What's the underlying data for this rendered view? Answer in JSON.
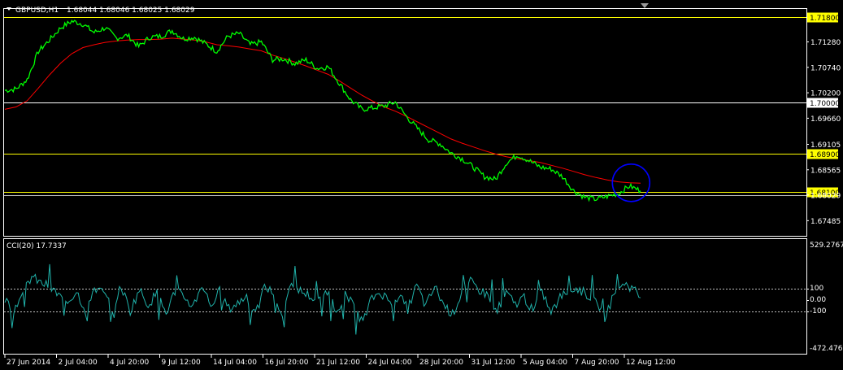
{
  "header": {
    "symbol": "GBPUSD,H1",
    "ohlc": "1.68044 1.68046 1.68025 1.68029"
  },
  "colors": {
    "background": "#000000",
    "price": "#00ff00",
    "ma": "#ff0000",
    "cci": "#20b2aa",
    "hline": "#ffff00",
    "hline_white": "#ffffff",
    "circle": "#0000ff",
    "axis": "#ffffff"
  },
  "indicator": {
    "name": "CCI(20) 17.7337",
    "levels": [
      "529.2767",
      "100",
      "0.00",
      "-100",
      "-472.476"
    ]
  },
  "chart_data": [
    {
      "type": "line",
      "title": "GBPUSD,H1",
      "x": [
        "27 Jun 2014",
        "2 Jul 04:00",
        "4 Jul 20:00",
        "9 Jul 12:00",
        "14 Jul 04:00",
        "16 Jul 20:00",
        "21 Jul 12:00",
        "24 Jul 04:00",
        "28 Jul 20:00",
        "31 Jul 12:00",
        "5 Aug 04:00",
        "7 Aug 20:00",
        "12 Aug 12:00"
      ],
      "y_ticks": [
        "1.71800",
        "1.71280",
        "1.70740",
        "1.70200",
        "1.70000",
        "1.69660",
        "1.69105",
        "1.68900",
        "1.68565",
        "1.68100",
        "1.68029",
        "1.67485"
      ],
      "ylim": [
        1.6718,
        1.7198
      ],
      "grid": false,
      "series": [
        {
          "name": "",
          "values": [
            1.7025,
            1.7028,
            1.7048,
            1.7108,
            1.7132,
            1.7158,
            1.7172,
            1.7166,
            1.7148,
            1.7158,
            1.7136,
            1.7142,
            1.7118,
            1.7138,
            1.714,
            1.7152,
            1.7135,
            1.7138,
            1.7124,
            1.7108,
            1.714,
            1.7146,
            1.7122,
            1.7128,
            1.709,
            1.7092,
            1.7082,
            1.709,
            1.7072,
            1.7075,
            1.704,
            1.7005,
            1.6985,
            1.6988,
            1.6992,
            1.7,
            1.697,
            1.6944,
            1.692,
            1.6912,
            1.6892,
            1.688,
            1.6862,
            1.6842,
            1.6836,
            1.6872,
            1.6888,
            1.6876,
            1.6862,
            1.6858,
            1.6842,
            1.6812,
            1.6798,
            1.6794,
            1.68,
            1.6806,
            1.6822,
            1.6812
          ]
        },
        {
          "name": "",
          "values": [
            1.6985,
            1.699,
            1.7003,
            1.703,
            1.7058,
            1.7083,
            1.7103,
            1.7116,
            1.7122,
            1.7127,
            1.713,
            1.7132,
            1.7133,
            1.7133,
            1.7134,
            1.7136,
            1.7134,
            1.7132,
            1.7128,
            1.7122,
            1.712,
            1.7117,
            1.7113,
            1.7109,
            1.71,
            1.7093,
            1.7085,
            1.7077,
            1.7068,
            1.7059,
            1.7045,
            1.703,
            1.7015,
            1.7002,
            1.699,
            1.6981,
            1.697,
            1.6958,
            1.6946,
            1.6934,
            1.6922,
            1.6913,
            1.6905,
            1.6897,
            1.689,
            1.6884,
            1.688,
            1.6876,
            1.6872,
            1.6866,
            1.686,
            1.6853,
            1.6846,
            1.684,
            1.6835,
            1.6831,
            1.6829,
            1.6828
          ]
        }
      ],
      "horizontal_lines": [
        {
          "value": 1.718,
          "color": "#ffff00",
          "tag": "1.71800"
        },
        {
          "value": 1.7,
          "color": "#ffffff",
          "tag": "1.70000"
        },
        {
          "value": 1.689,
          "color": "#ffff00",
          "tag": "1.68900"
        },
        {
          "value": 1.681,
          "color": "#ffff00",
          "tag": "1.68100"
        },
        {
          "value": 1.68029,
          "color": "#c0c0c0",
          "tag": ""
        }
      ],
      "highlight": {
        "x_index": 56,
        "value": 1.6822
      }
    },
    {
      "type": "line",
      "title": "CCI(20) 17.7337",
      "ylim": [
        -472.476,
        529.2767
      ],
      "levels": [
        100,
        0,
        -100
      ],
      "series": [
        {
          "name": "",
          "values": [
            10,
            -80,
            60,
            210,
            150,
            120,
            40,
            -20,
            80,
            -90,
            110,
            60,
            -70,
            120,
            -100,
            90,
            -40,
            60,
            -120,
            80,
            30,
            -60,
            140,
            -50,
            80,
            -80,
            -30,
            40,
            -140,
            120,
            60,
            -150,
            170,
            80,
            40,
            -20,
            90,
            -110,
            60,
            -70,
            -200,
            20,
            70,
            -20,
            40,
            -80,
            130,
            -60,
            120,
            -40,
            -130,
            60,
            160,
            90,
            40,
            -90,
            60,
            -40,
            30,
            -110,
            80,
            -120,
            20,
            90,
            100,
            50,
            -10,
            -150,
            40,
            160,
            110,
            20
          ]
        }
      ]
    }
  ]
}
